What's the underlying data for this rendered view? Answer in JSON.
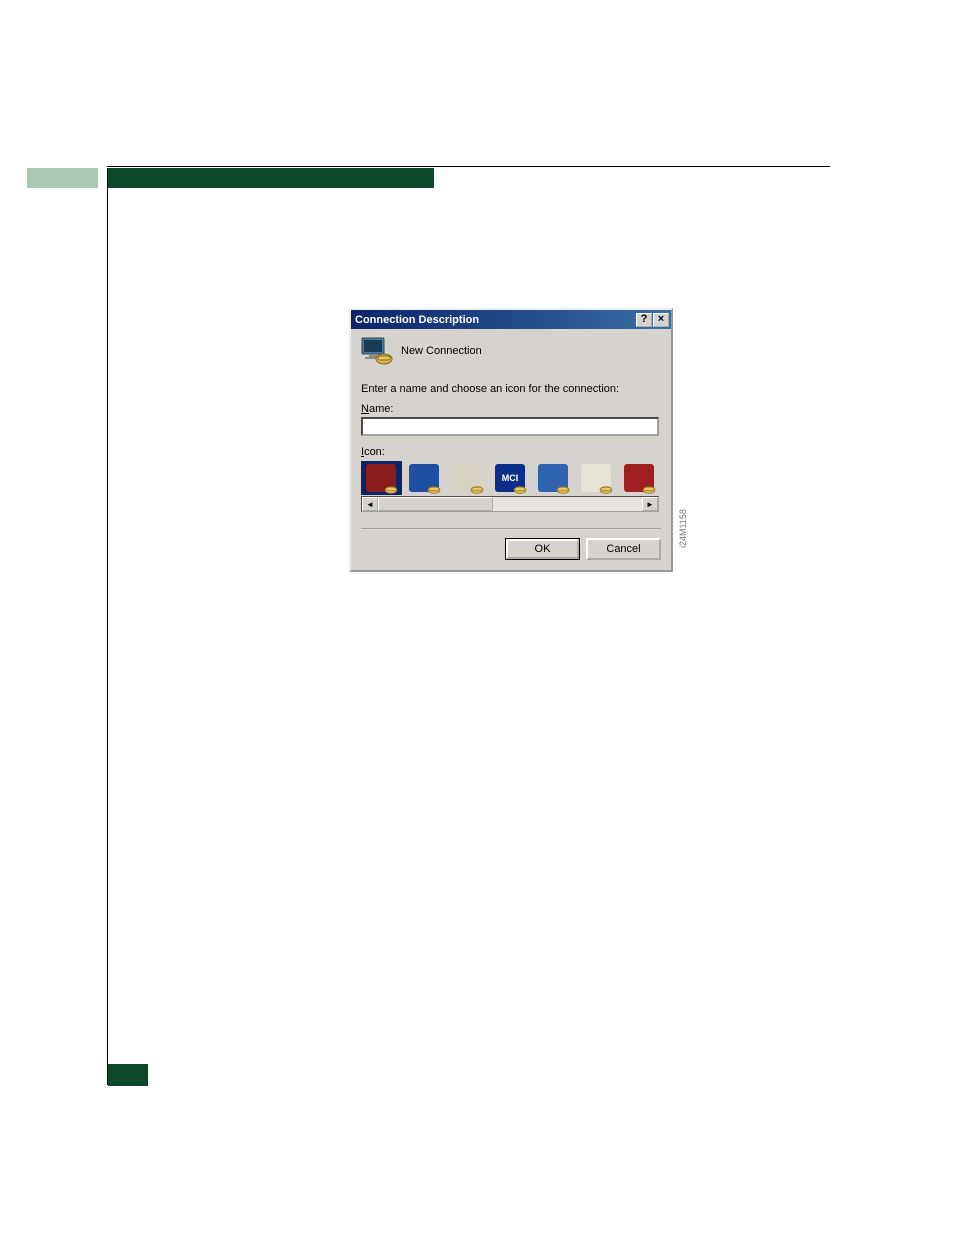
{
  "page": {
    "figure_id": "i24M1158"
  },
  "dialog": {
    "title": "Connection Description",
    "help_glyph": "?",
    "close_glyph": "×",
    "new_connection_label": "New Connection",
    "prompt": "Enter a name and choose an icon for the connection:",
    "name_label_underline": "N",
    "name_label_rest": "ame:",
    "name_value": "",
    "icon_label_underline": "I",
    "icon_label_rest": "con:",
    "scroll_left_glyph": "◄",
    "scroll_right_glyph": "►",
    "ok_label": "OK",
    "cancel_label": "Cancel",
    "icons": [
      {
        "name": "icon-red-globe",
        "bg": "#8a1c1c",
        "selected": true,
        "badge_text": ""
      },
      {
        "name": "icon-att-globe",
        "bg": "#1e4fa3",
        "selected": false,
        "badge_text": ""
      },
      {
        "name": "icon-news-mail",
        "bg": "#d8d2c4",
        "selected": false,
        "badge_text": ""
      },
      {
        "name": "icon-mci",
        "bg": "#0b2e8a",
        "selected": false,
        "badge_text": "MCI"
      },
      {
        "name": "icon-ge-circle",
        "bg": "#2f63b0",
        "selected": false,
        "badge_text": ""
      },
      {
        "name": "icon-document",
        "bg": "#e7e2d6",
        "selected": false,
        "badge_text": ""
      },
      {
        "name": "icon-red-umbrella",
        "bg": "#a02020",
        "selected": false,
        "badge_text": ""
      }
    ]
  }
}
